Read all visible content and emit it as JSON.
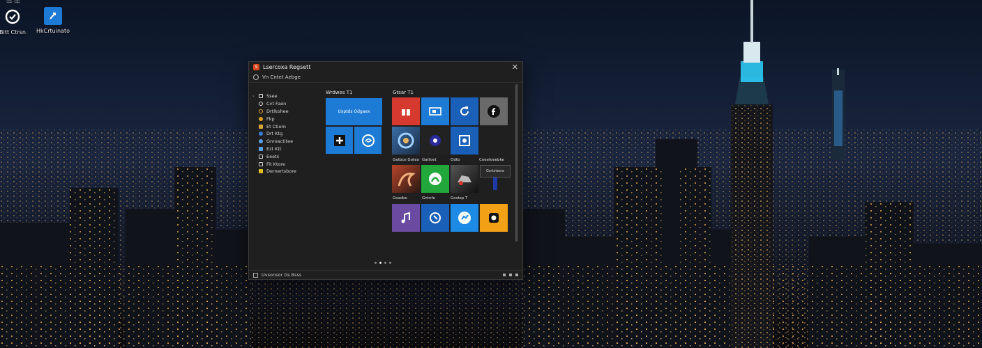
{
  "desktop": {
    "top_hint": "ಯ ಯ",
    "icons": [
      {
        "label": "Bitt Ctrsn",
        "icon": "sync-icon"
      },
      {
        "label": "HkCrtuinato",
        "icon": "app-icon"
      }
    ]
  },
  "window": {
    "title": "Lsercoxa Regsett",
    "subtitle": "Vn Cntet Aebge",
    "sidebar": [
      {
        "label": "Ssee",
        "icon": "square-icon",
        "color": "#dddddd"
      },
      {
        "label": "Cvt Faen",
        "icon": "circle-icon",
        "color": "#dddddd"
      },
      {
        "label": "Drtlkohee",
        "icon": "circle-icon",
        "color": "#e8a23a"
      },
      {
        "label": "Fkp",
        "icon": "bulb-icon",
        "color": "#e0a020"
      },
      {
        "label": "Et Ctiom",
        "icon": "folder-icon",
        "color": "#d6a63a"
      },
      {
        "label": "Drt Ktg",
        "icon": "globe-icon",
        "color": "#3a7ad6"
      },
      {
        "label": "Gnroactitee",
        "icon": "cloud-icon",
        "color": "#5aa0e6"
      },
      {
        "label": "Ezt Ktt",
        "icon": "image-icon",
        "color": "#5aa0e6"
      },
      {
        "label": "Eeets",
        "icon": "square-icon",
        "color": "#cccccc"
      },
      {
        "label": "Fit Ktore",
        "icon": "pen-icon",
        "color": "#cccccc"
      },
      {
        "label": "Dernertsbore",
        "icon": "sticker-icon",
        "color": "#e0c020"
      }
    ],
    "groups": [
      {
        "label": "Wrdwes T1"
      },
      {
        "label": "Gtsar T1"
      },
      {
        "label": "Gatbce Goteo"
      },
      {
        "label": "Gatfoet"
      },
      {
        "label": "Odtb"
      },
      {
        "label": "Ceeefoeebke"
      },
      {
        "label": "Gsadbo"
      },
      {
        "label": "Gntnfe"
      },
      {
        "label": "Gcotsp T"
      }
    ],
    "wide_tile_label": "Uxptds Odgaex",
    "small_button_label": "Gsrtxtesre",
    "statusbar_label": "Uvsonsor Gs Bsss",
    "colors": {
      "accent_blue": "#1d7bd6",
      "red": "#d63a2f",
      "green": "#22a83a",
      "purple": "#6b4aa2",
      "orange": "#f2a015",
      "gray": "#6a6a6a"
    }
  }
}
